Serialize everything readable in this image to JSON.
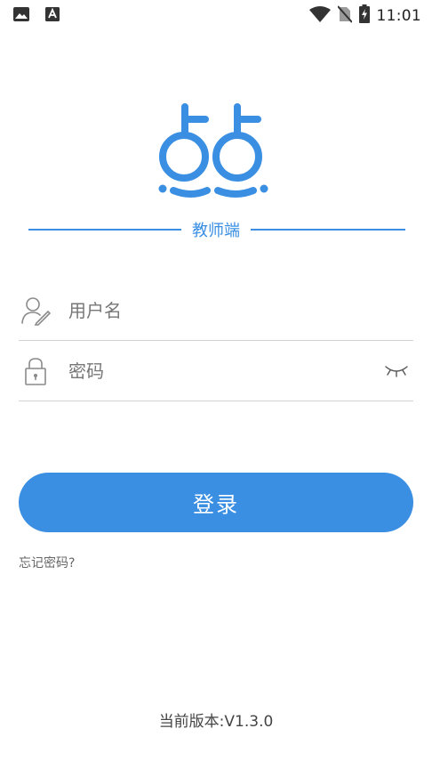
{
  "status_bar": {
    "time": "11:01",
    "left_icons": [
      "image-icon",
      "app-notification-icon"
    ],
    "right_icons": [
      "wifi-icon",
      "no-sim-icon",
      "battery-charging-icon"
    ]
  },
  "branding": {
    "logo": "app-logo",
    "subtitle": "教师端",
    "accent_color": "#3a8fe3"
  },
  "form": {
    "username": {
      "placeholder": "用户名",
      "value": "",
      "icon": "user-icon"
    },
    "password": {
      "placeholder": "密码",
      "value": "",
      "icon": "lock-icon",
      "toggle_icon": "eye-closed-icon"
    }
  },
  "login_button": {
    "label": "登录"
  },
  "forgot_password": {
    "label": "忘记密码?"
  },
  "footer": {
    "version": "当前版本:V1.3.0"
  }
}
